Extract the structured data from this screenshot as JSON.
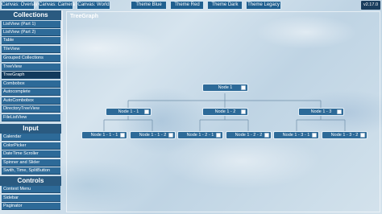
{
  "top_tabs": [
    "Canvas: Overlay",
    "Canvas: Camera",
    "Canvas: World"
  ],
  "theme_buttons": [
    "Theme Blue",
    "Theme Red",
    "Theme Dark",
    "Theme Legacy"
  ],
  "version": "v2.17.0",
  "sidebar": {
    "sections": [
      {
        "title": "Collections",
        "items": [
          "ListView (Part 1)",
          "ListView (Part 2)",
          "Table",
          "TileView",
          "Grouped Collections",
          "TreeView",
          "TreeGraph",
          "Combobox",
          "Autocomplete",
          "AutoCombobox",
          "DirectoryTreeView",
          "FileListView"
        ]
      },
      {
        "title": "Input",
        "items": [
          "Calendar",
          "ColorPicker",
          "DateTime Scroller",
          "Spinner and Slider",
          "Swith, Time, SplitButton"
        ]
      },
      {
        "title": "Controls",
        "items": [
          "Context Menu",
          "Sidebar",
          "Paginator"
        ]
      }
    ],
    "selected": "TreeGraph"
  },
  "main": {
    "title": "TreeGraph",
    "root": "Node 1",
    "level1": [
      "Node 1 - 1",
      "Node 1 - 2",
      "Node 1 - 3"
    ],
    "level2": [
      "Node 1 - 1 - 1",
      "Node 1 - 1 - 2",
      "Node 1 - 2 - 1",
      "Node 1 - 2 - 2",
      "Node 1 - 3 - 1",
      "Node 1 - 3 - 2"
    ]
  }
}
